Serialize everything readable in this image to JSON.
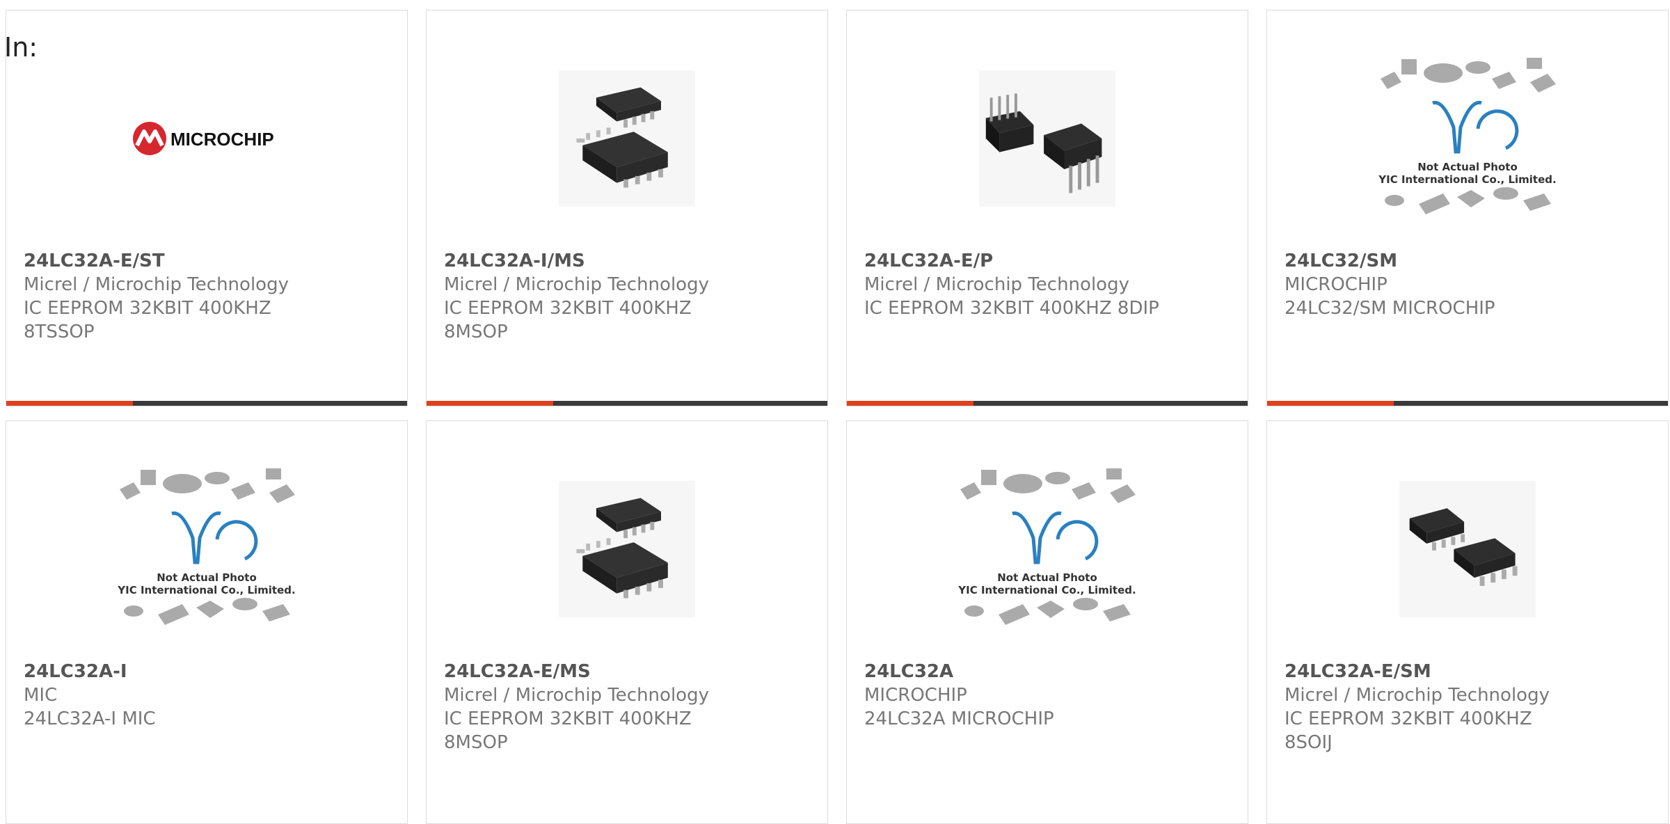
{
  "page": {
    "label": "In:"
  },
  "colors": {
    "accent": "#e0401c",
    "bar": "#3a3a3a",
    "border": "#dcdcdc"
  },
  "cards": [
    {
      "part": "24LC32A-E/ST",
      "lines": [
        "Micrel / Microchip Technology",
        "IC EEPROM 32KBIT 400KHZ",
        "8TSSOP"
      ],
      "image": "microchip-logo",
      "logo_text": "MICROCHIP"
    },
    {
      "part": "24LC32A-I/MS",
      "lines": [
        "Micrel / Microchip Technology",
        "IC EEPROM 32KBIT 400KHZ",
        "8MSOP"
      ],
      "image": "msop-chip-photo"
    },
    {
      "part": "24LC32A-E/P",
      "lines": [
        "Micrel / Microchip Technology",
        "IC EEPROM 32KBIT 400KHZ 8DIP",
        ""
      ],
      "image": "dip-chip-photo"
    },
    {
      "part": "24LC32/SM",
      "lines": [
        "MICROCHIP",
        "24LC32/SM MICROCHIP",
        ""
      ],
      "image": "yic-placeholder",
      "ph_line1": "Not Actual Photo",
      "ph_line2": "YIC International Co., Limited."
    },
    {
      "part": "24LC32A-I",
      "lines": [
        "MIC",
        "24LC32A-I MIC",
        ""
      ],
      "image": "yic-placeholder",
      "ph_line1": "Not Actual Photo",
      "ph_line2": "YIC International Co., Limited."
    },
    {
      "part": "24LC32A-E/MS",
      "lines": [
        "Micrel / Microchip Technology",
        "IC EEPROM 32KBIT 400KHZ",
        "8MSOP"
      ],
      "image": "msop-chip-photo"
    },
    {
      "part": "24LC32A",
      "lines": [
        "MICROCHIP",
        "24LC32A MICROCHIP",
        ""
      ],
      "image": "yic-placeholder",
      "ph_line1": "Not Actual Photo",
      "ph_line2": "YIC International Co., Limited."
    },
    {
      "part": "24LC32A-E/SM",
      "lines": [
        "Micrel / Microchip Technology",
        "IC EEPROM 32KBIT 400KHZ",
        "8SOIJ"
      ],
      "image": "soic-chip-photo"
    }
  ]
}
